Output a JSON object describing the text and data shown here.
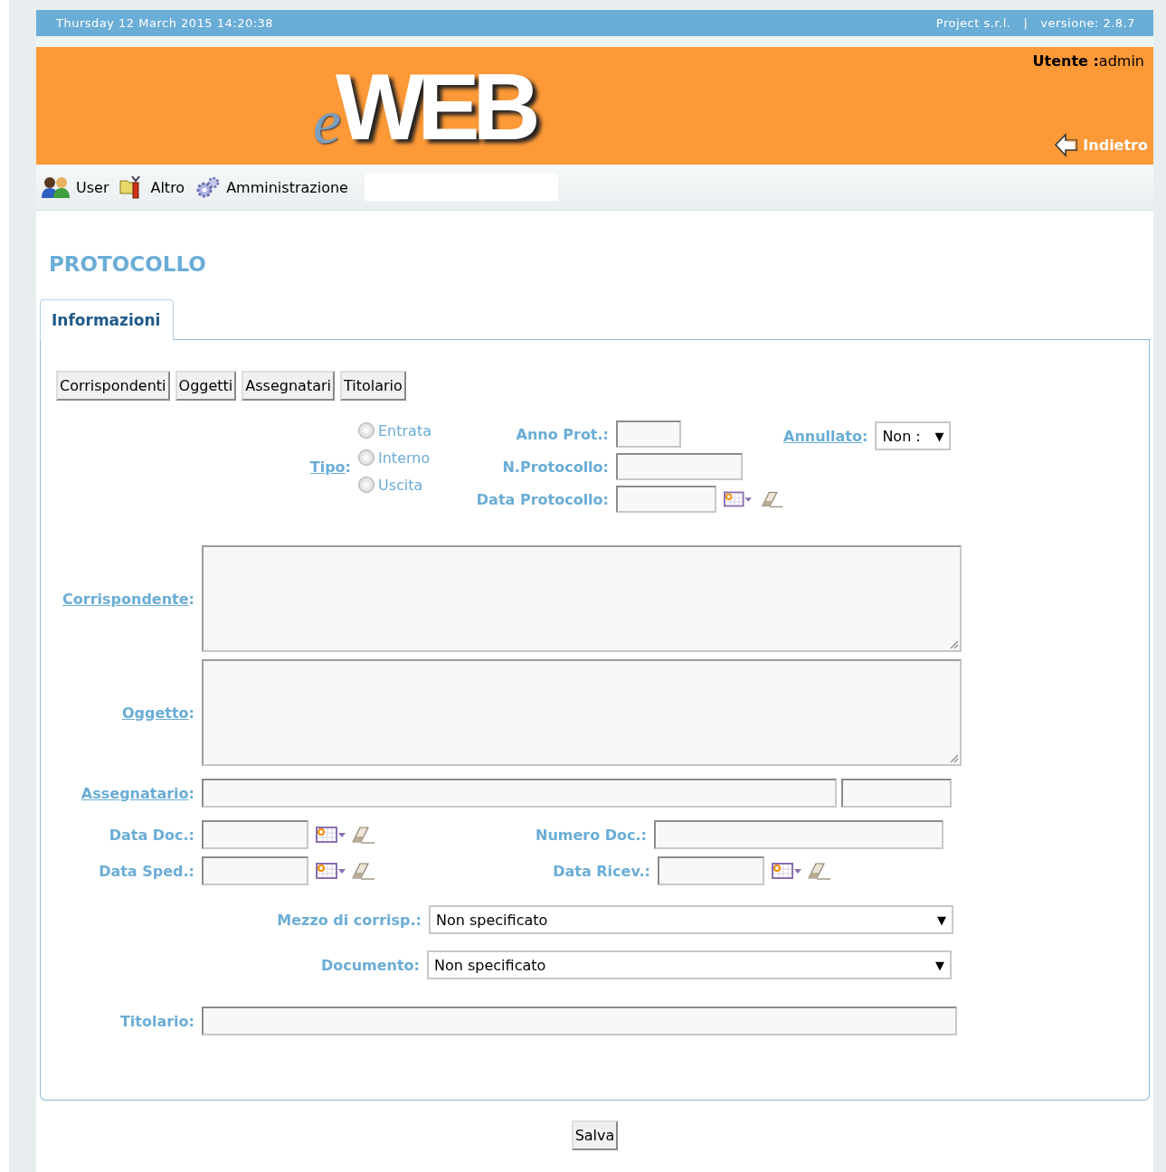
{
  "top_bar": {
    "datetime": "Thursday 12 March 2015 14:20:38",
    "company": "Project s.r.l.",
    "separator": "|",
    "version": "versione: 2.8.7"
  },
  "header": {
    "logo_prefix": "e",
    "logo_text": "WEB",
    "user_label": "Utente :",
    "user_name": "admin",
    "back_link": "Indietro"
  },
  "menu": [
    {
      "label": "User"
    },
    {
      "label": "Altro"
    },
    {
      "label": "Amministrazione"
    }
  ],
  "page_title": "PROTOCOLLO",
  "tabs": [
    {
      "label": "Informazioni",
      "selected": true
    }
  ],
  "section_buttons": [
    "Corrispondenti",
    "Oggetti",
    "Assegnatari",
    "Titolario"
  ],
  "tipo": {
    "label": "Tipo",
    "suffix": ":",
    "options": [
      {
        "label": "Entrata",
        "selected": false
      },
      {
        "label": "Interno",
        "selected": false
      },
      {
        "label": "Uscita",
        "selected": false
      }
    ]
  },
  "protocol_fields": [
    {
      "label": "Anno Prot.:",
      "kind": "short"
    },
    {
      "label": "N.Protocollo:",
      "kind": "medium"
    },
    {
      "label": "Data Protocollo:",
      "kind": "date"
    }
  ],
  "annullato": {
    "label": "Annullato",
    "suffix": ":",
    "value": "Non :",
    "caret": "▼"
  },
  "corrispondente": {
    "label": "Corrispondente",
    "suffix": ":"
  },
  "oggetto": {
    "label": "Oggetto",
    "suffix": ":"
  },
  "assegnatario": {
    "label": "Assegnatario",
    "suffix": ":"
  },
  "date_rows": [
    {
      "left_label": "Data Doc.:",
      "right_label": "Numero Doc.:",
      "kind": "text"
    },
    {
      "left_label": "Data Sped.:",
      "right_label": "Data Ricev.:",
      "kind": "date"
    }
  ],
  "selects": [
    {
      "label": "Mezzo di corrisp.:",
      "value": "Non specificato",
      "caret": "▼"
    },
    {
      "label": "Documento:",
      "value": "Non specificato",
      "caret": "▼"
    }
  ],
  "titolario": {
    "label": "Titolario:"
  },
  "save_button": "Salva"
}
